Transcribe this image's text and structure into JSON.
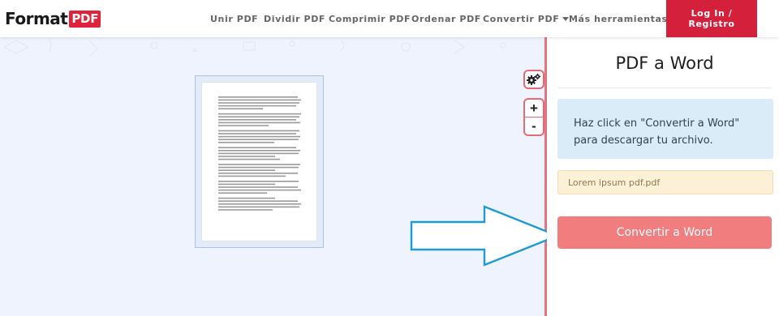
{
  "brand": {
    "name": "Format",
    "badge": "PDF"
  },
  "nav": {
    "items": [
      {
        "label": "Unir PDF"
      },
      {
        "label": "Dividir PDF"
      },
      {
        "label": "Comprimir PDF"
      },
      {
        "label": "Ordenar PDF"
      },
      {
        "label": "Convertir PDF",
        "dropdown": true
      },
      {
        "label": "Más herramientas",
        "dropdown": true
      }
    ],
    "login_label": "Log In / Registro"
  },
  "viewer": {
    "tools": {
      "settings_icon": "gear-icon",
      "zoom_in": "+",
      "zoom_out": "-"
    },
    "arrow_color": "#1f9bd1"
  },
  "panel": {
    "title": "PDF a Word",
    "info": "Haz click en \"Convertir a Word\" para descargar tu archivo.",
    "filename": "Lorem ipsum pdf.pdf",
    "convert_label": "Convertir a Word"
  },
  "colors": {
    "brand_red": "#d5203b",
    "convert_button": "#f17d7e",
    "info_bg": "#d9ecf7",
    "file_bg": "#fcf0d6",
    "viewer_bg": "#eef3fd"
  }
}
